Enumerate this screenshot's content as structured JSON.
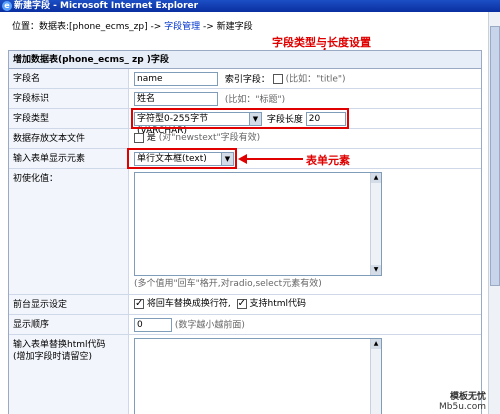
{
  "window": {
    "title": "新建字段 - Microsoft Internet Explorer"
  },
  "breadcrumb": {
    "prefix": "位置：数据表:[phone_ecms_zp] -> ",
    "link1": "字段管理",
    "sep": " -> ",
    "current": "新建字段"
  },
  "annotations": {
    "type_length": "字段类型与长度设置",
    "form_element": "表单元素"
  },
  "form": {
    "header": "增加数据表(phone_ecms_ zp )字段",
    "field_name": {
      "label": "字段名",
      "value": "name",
      "index_label": "索引字段：",
      "index_hint": "(比如：\"title\")"
    },
    "field_id": {
      "label": "字段标识",
      "value": "姓名",
      "hint": "(比如：\"标题\")"
    },
    "field_type": {
      "label": "字段类型",
      "selected": "字符型0-255字节(VARCHAR)",
      "length_label": "字段长度",
      "length_value": "20"
    },
    "text_store": {
      "label": "数据存放文本文件",
      "option": "是",
      "hint": "(对\"newstext\"字段有效)"
    },
    "input_element": {
      "label": "输入表单显示元素",
      "selected": "单行文本框(text)"
    },
    "init_value": {
      "label": "初使化值：",
      "hint": "(多个值用\"回车\"格开,对radio,select元素有效)"
    },
    "front_display": {
      "label": "前台显示设定",
      "opt1": "将回车替换成换行符,",
      "opt2": "支持html代码"
    },
    "order": {
      "label": "显示顺序",
      "value": "0",
      "hint": "(数字越小越前面)"
    },
    "replace_html": {
      "label": "输入表单替换html代码\n(增加字段时请留空)"
    }
  },
  "watermark": {
    "brand": "模板无忧",
    "site": "Mb5u.com"
  }
}
